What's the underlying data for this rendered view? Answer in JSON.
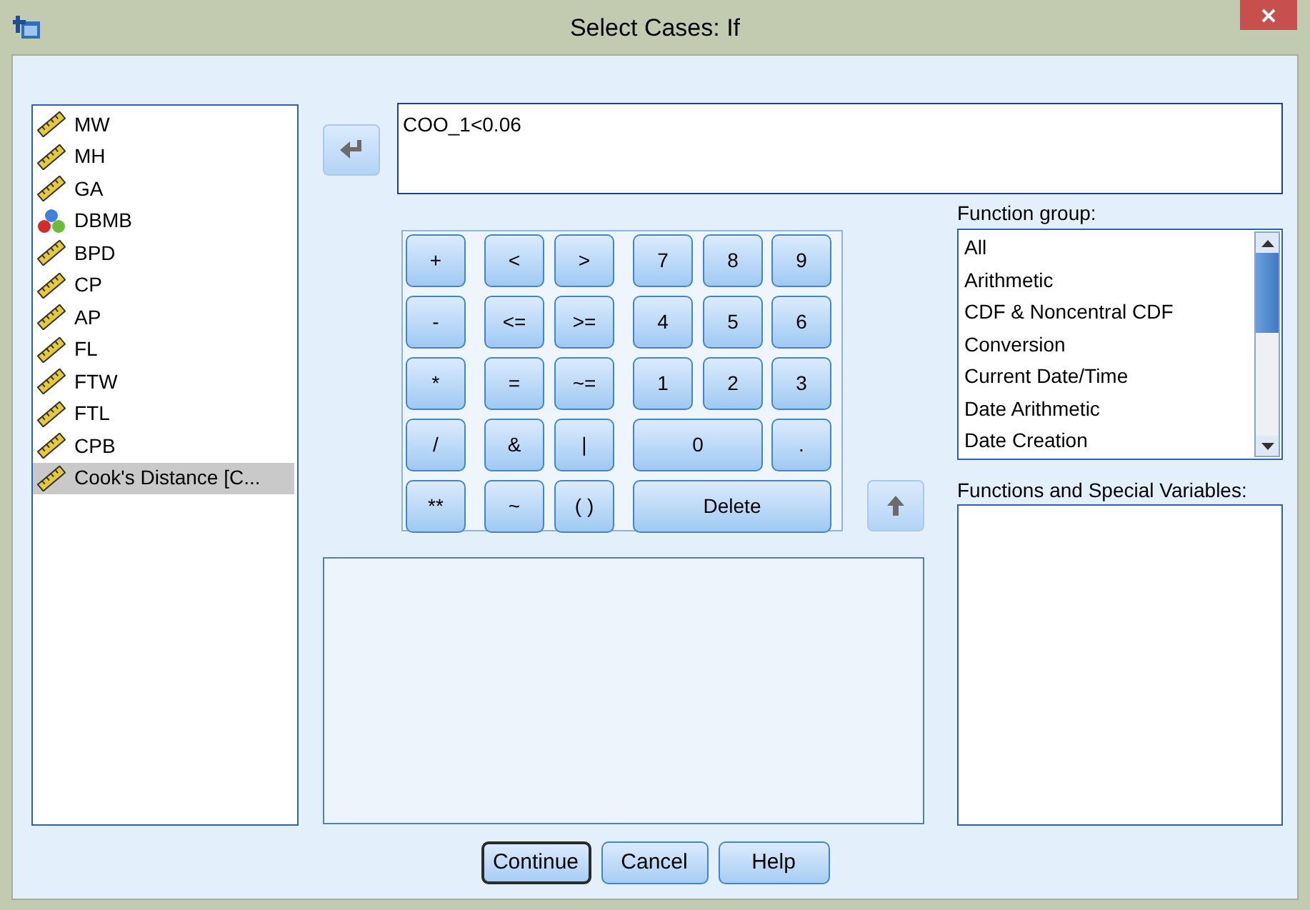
{
  "window": {
    "title": "Select Cases: If"
  },
  "variables": [
    {
      "name": "MW",
      "kind": "scale",
      "selected": false
    },
    {
      "name": "MH",
      "kind": "scale",
      "selected": false
    },
    {
      "name": "GA",
      "kind": "scale",
      "selected": false
    },
    {
      "name": "DBMB",
      "kind": "nominal",
      "selected": false
    },
    {
      "name": "BPD",
      "kind": "scale",
      "selected": false
    },
    {
      "name": "CP",
      "kind": "scale",
      "selected": false
    },
    {
      "name": "AP",
      "kind": "scale",
      "selected": false
    },
    {
      "name": "FL",
      "kind": "scale",
      "selected": false
    },
    {
      "name": "FTW",
      "kind": "scale",
      "selected": false
    },
    {
      "name": "FTL",
      "kind": "scale",
      "selected": false
    },
    {
      "name": "CPB",
      "kind": "scale",
      "selected": false
    },
    {
      "name": "Cook's Distance [C...",
      "kind": "scale",
      "selected": true
    }
  ],
  "expression": {
    "value": "COO_1<0.06"
  },
  "keypad": [
    [
      "+",
      "<",
      ">",
      "7",
      "8",
      "9"
    ],
    [
      "-",
      "<=",
      ">=",
      "4",
      "5",
      "6"
    ],
    [
      "*",
      "=",
      "~=",
      "1",
      "2",
      "3"
    ],
    [
      "/",
      "&",
      "|",
      "0",
      "."
    ],
    [
      "**",
      "~",
      "( )",
      "Delete"
    ]
  ],
  "function_group": {
    "label": "Function group:",
    "items": [
      {
        "label": "All",
        "selected": false
      },
      {
        "label": "Arithmetic",
        "selected": false
      },
      {
        "label": "CDF & Noncentral CDF",
        "selected": false
      },
      {
        "label": "Conversion",
        "selected": false
      },
      {
        "label": "Current Date/Time",
        "selected": false
      },
      {
        "label": "Date Arithmetic",
        "selected": false
      },
      {
        "label": "Date Creation",
        "selected": false
      }
    ]
  },
  "functions": {
    "label": "Functions and Special Variables:"
  },
  "buttons": [
    {
      "label": "Continue",
      "default": true
    },
    {
      "label": "Cancel",
      "default": false
    },
    {
      "label": "Help",
      "default": false
    }
  ]
}
